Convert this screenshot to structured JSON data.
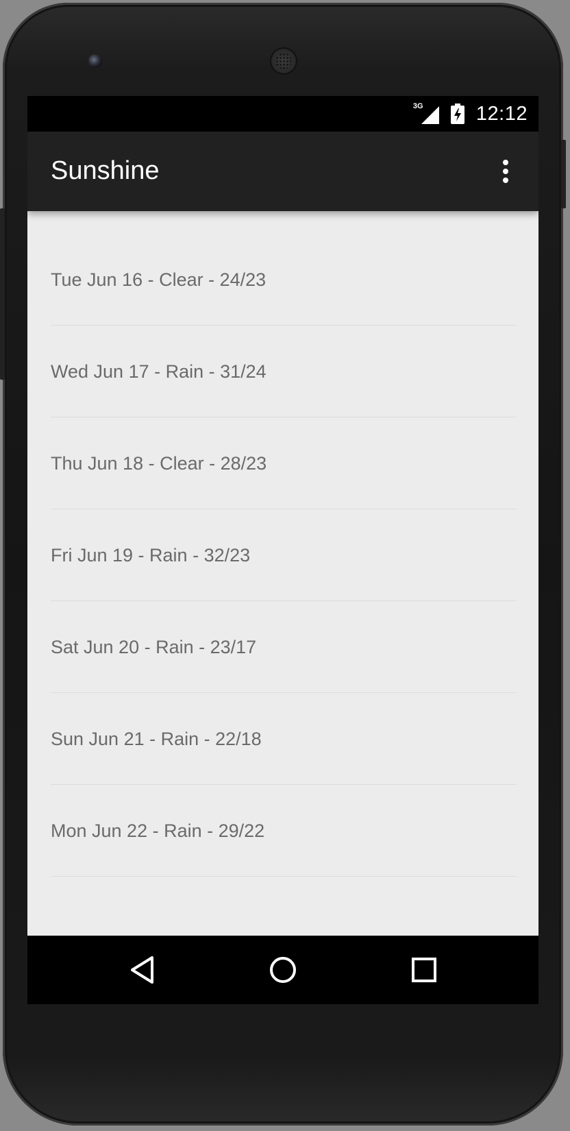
{
  "status_bar": {
    "network_type": "3G",
    "time": "12:12",
    "signal_icon": "cell-signal-icon",
    "battery_icon": "battery-charging-icon"
  },
  "app_bar": {
    "title": "Sunshine",
    "overflow_icon": "more-vert-icon"
  },
  "forecast": {
    "items": [
      {
        "label": "Tue Jun 16 - Clear - 24/23"
      },
      {
        "label": "Wed Jun 17 - Rain - 31/24"
      },
      {
        "label": "Thu Jun 18 - Clear - 28/23"
      },
      {
        "label": "Fri Jun 19 - Rain - 32/23"
      },
      {
        "label": "Sat Jun 20 - Rain - 23/17"
      },
      {
        "label": "Sun Jun 21 - Rain - 22/18"
      },
      {
        "label": "Mon Jun 22 - Rain - 29/22"
      }
    ]
  },
  "nav_bar": {
    "back_icon": "back-triangle-icon",
    "home_icon": "home-circle-icon",
    "recents_icon": "recents-square-icon"
  },
  "colors": {
    "app_bar": "#212121",
    "list_background": "#ececec",
    "list_text": "#6a6a6a",
    "divider": "#dcdcdc",
    "system_bars": "#000000"
  }
}
